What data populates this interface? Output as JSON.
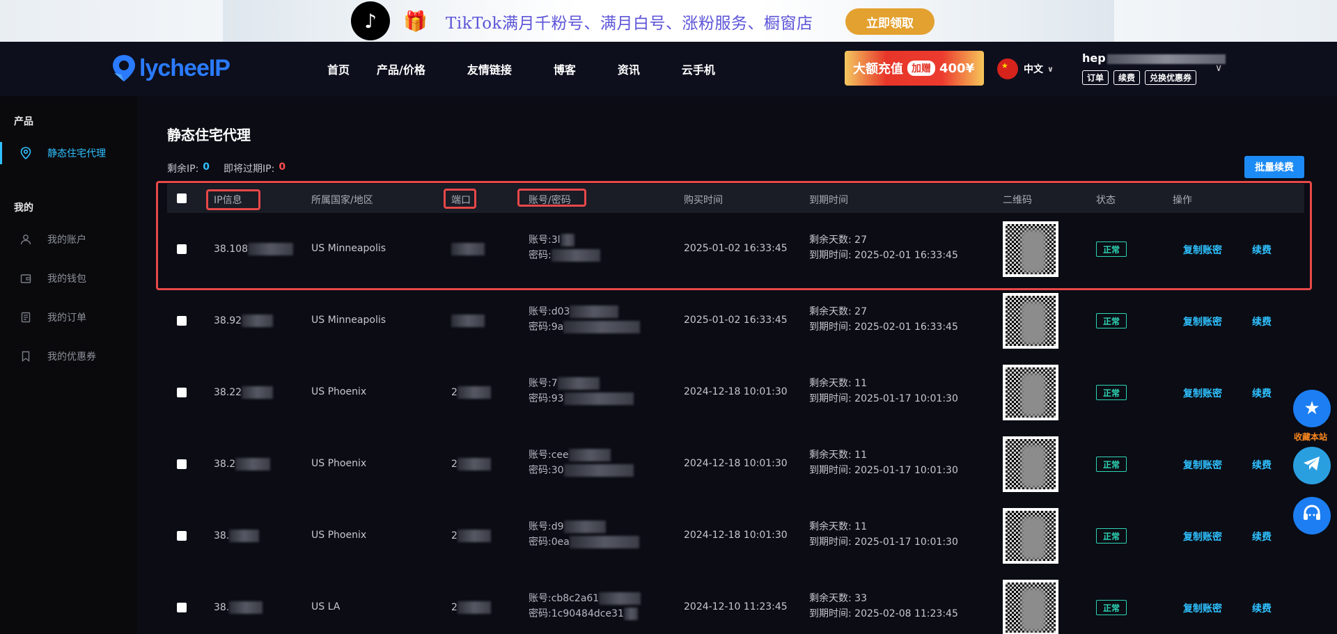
{
  "promo": {
    "text": "TikTok满月千粉号、满月白号、涨粉服务、橱窗店",
    "button": "立即领取"
  },
  "header": {
    "logo": "lycheeIP",
    "nav": [
      "首页",
      "产品/价格",
      "友情链接",
      "博客",
      "资讯",
      "云手机"
    ],
    "recharge": {
      "text": "大额充值",
      "tag": "加赠",
      "amount": "400¥"
    },
    "language": "中文",
    "user": {
      "name_prefix": "hep",
      "links": [
        "订单",
        "续费",
        "兑换优惠券"
      ]
    }
  },
  "sidebar": {
    "group_product": "产品",
    "group_mine": "我的",
    "items": [
      {
        "label": "静态住宅代理",
        "icon": "location-pin-icon",
        "active": true
      },
      {
        "label": "我的账户",
        "icon": "user-icon"
      },
      {
        "label": "我的钱包",
        "icon": "wallet-icon"
      },
      {
        "label": "我的订单",
        "icon": "order-icon"
      },
      {
        "label": "我的优惠券",
        "icon": "bookmark-icon"
      }
    ]
  },
  "main": {
    "title": "静态住宅代理",
    "remaining_label": "剩余IP:",
    "remaining_value": "0",
    "expiring_label": "即将过期IP:",
    "expiring_value": "0",
    "batch_renew": "批量续费",
    "columns": [
      "IP信息",
      "所属国家/地区",
      "端口",
      "账号/密码",
      "购买时间",
      "到期时间",
      "二维码",
      "状态",
      "操作"
    ],
    "account_label": "账号:",
    "password_label": "密码:",
    "days_label": "剩余天数:",
    "expire_label": "到期时间:",
    "copy_action": "复制账密",
    "renew_action": "续费",
    "rows": [
      {
        "ip": "38.108",
        "region": "US Minneapolis",
        "port": "",
        "account": "3l",
        "password": "",
        "purchase": "2025-01-02 16:33:45",
        "days": "27",
        "expire": "2025-02-01 16:33:45",
        "status": "正常"
      },
      {
        "ip": "38.92",
        "region": "US Minneapolis",
        "port": "",
        "account": "d03",
        "password": "9a",
        "purchase": "2025-01-02 16:33:45",
        "days": "27",
        "expire": "2025-02-01 16:33:45",
        "status": "正常"
      },
      {
        "ip": "38.22",
        "region": "US Phoenix",
        "port": "2",
        "account": "7",
        "password": "93",
        "purchase": "2024-12-18 10:01:30",
        "days": "11",
        "expire": "2025-01-17 10:01:30",
        "status": "正常"
      },
      {
        "ip": "38.2",
        "region": "US Phoenix",
        "port": "2",
        "account": "cee",
        "password": "30",
        "purchase": "2024-12-18 10:01:30",
        "days": "11",
        "expire": "2025-01-17 10:01:30",
        "status": "正常"
      },
      {
        "ip": "38.",
        "region": "US Phoenix",
        "port": "2",
        "account": "d9",
        "password": "0ea",
        "purchase": "2024-12-18 10:01:30",
        "days": "11",
        "expire": "2025-01-17 10:01:30",
        "status": "正常"
      },
      {
        "ip": "38.",
        "region": "US LA",
        "port": "2",
        "account": "cb8c2a61",
        "password": "1c90484dce31",
        "purchase": "2024-12-10 11:23:45",
        "days": "33",
        "expire": "2025-02-08 11:23:45",
        "status": "正常"
      }
    ]
  },
  "floating": {
    "favorite_label": "收藏本站"
  }
}
